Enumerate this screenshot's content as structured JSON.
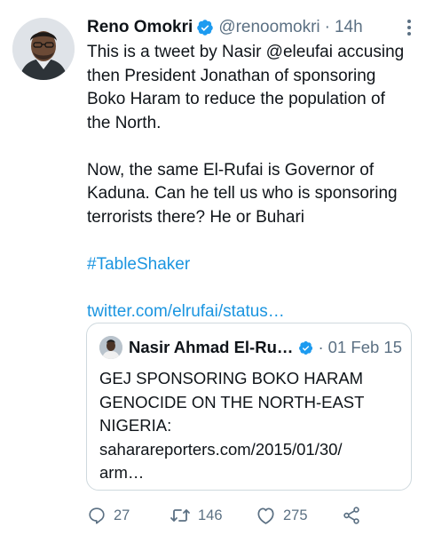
{
  "tweet": {
    "author_name": "Reno Omokri",
    "author_handle": "@renoomokri",
    "separator": "·",
    "time": "14h",
    "paragraphs": [
      "This is a tweet by Nasir @eleufai accusing then President Jonathan of sponsoring Boko Haram to reduce the population of the North.",
      "Now, the same El-Rufai is Governor of Kaduna. Can he tell us who is sponsoring terrorists there? He or Buhari"
    ],
    "hashtag": "#TableShaker",
    "link": "twitter.com/elrufai/status…"
  },
  "quoted": {
    "author_name": "Nasir Ahmad El-Ru…",
    "separator": "·",
    "date": "01 Feb 15",
    "lines": [
      "GEJ SPONSORING BOKO HARAM",
      "GENOCIDE ON THE NORTH-EAST",
      "NIGERIA:",
      "saharareporters.com/2015/01/30/",
      "arm…"
    ]
  },
  "actions": {
    "reply_count": "27",
    "retweet_count": "146",
    "like_count": "275"
  },
  "colors": {
    "accent": "#1b95e0",
    "secondary_text": "#5b7083",
    "verified": "#1d9bf0",
    "border": "#cfd9de"
  },
  "icons": [
    "verified-badge-icon",
    "more-options-icon",
    "reply-icon",
    "retweet-icon",
    "like-icon",
    "share-icon"
  ]
}
